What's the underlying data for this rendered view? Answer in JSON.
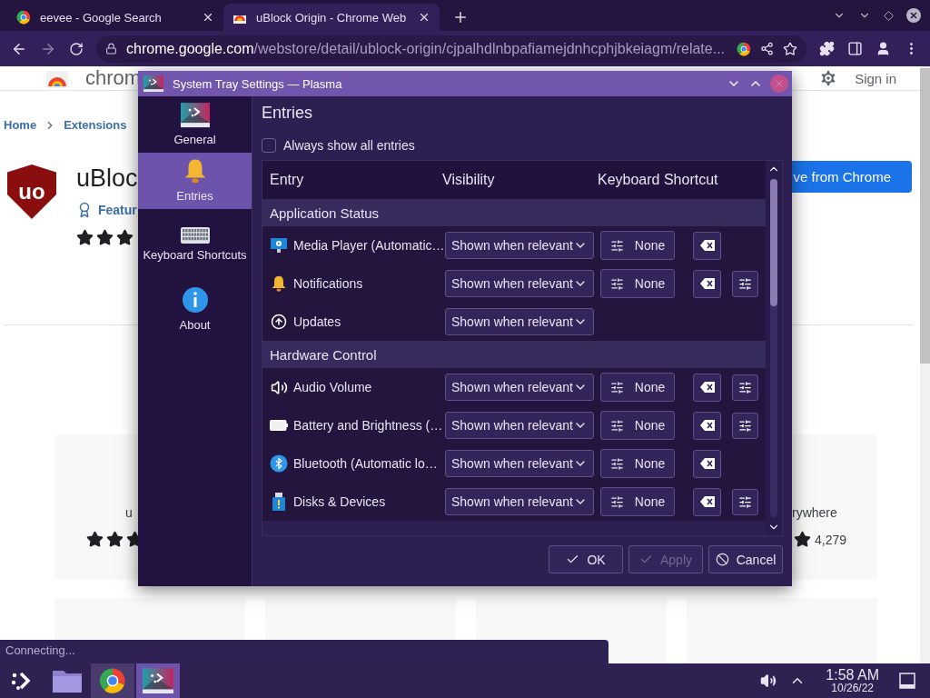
{
  "browser": {
    "tabs": [
      {
        "title": "eevee - Google Search",
        "selected": false
      },
      {
        "title": "uBlock Origin - Chrome Web",
        "selected": true
      }
    ],
    "url": "**chrome.google.com**/webstore/detail/ublock-origin/cjpalhdlnbpafiamejdnhcphjbkeiagm/relate...",
    "page": {
      "logo_text": "chrom",
      "sign_in": "Sign in",
      "breadcrumb": [
        "Home",
        "Extensions"
      ],
      "extension": {
        "badge_text": "uo",
        "title": "uBloc",
        "featured": "Featur",
        "stars": 3,
        "button": "ve from Chrome"
      },
      "cards": [
        {
          "title": "u",
          "stars": 3
        },
        {
          "title": "rywhere",
          "rating": "4,279"
        }
      ]
    }
  },
  "dialog": {
    "title": "System Tray Settings — Plasma",
    "nav": [
      {
        "label": "General",
        "selected": false
      },
      {
        "label": "Entries",
        "selected": true
      },
      {
        "label": "Keyboard Shortcuts",
        "selected": false
      },
      {
        "label": "About",
        "selected": false
      }
    ],
    "heading": "Entries",
    "always_show": {
      "label": "Always show all entries",
      "checked": false
    },
    "columns": [
      "Entry",
      "Visibility",
      "Keyboard Shortcut"
    ],
    "groups": [
      {
        "name": "Application Status",
        "entries": [
          {
            "name": "Media Player (Automatic…",
            "visibility": "Shown when relevant",
            "shortcut": "None",
            "configurable": false,
            "disabled": false
          },
          {
            "name": "Notifications",
            "visibility": "Shown when relevant",
            "shortcut": "None",
            "configurable": true,
            "disabled": false
          },
          {
            "name": "Updates",
            "visibility": "Shown when relevant",
            "configurable": false,
            "disabled": false
          }
        ]
      },
      {
        "name": "Hardware Control",
        "entries": [
          {
            "name": "Audio Volume",
            "visibility": "Shown when relevant",
            "shortcut": "None",
            "configurable": true,
            "disabled": false
          },
          {
            "name": "Battery and Brightness (…",
            "visibility": "Shown when relevant",
            "shortcut": "None",
            "configurable": true,
            "disabled": false
          },
          {
            "name": "Bluetooth (Automatic lo…",
            "visibility": "Shown when relevant",
            "shortcut": "None",
            "configurable": false,
            "disabled": false
          },
          {
            "name": "Disks & Devices",
            "visibility": "Shown when relevant",
            "shortcut": "None",
            "configurable": true,
            "disabled": false
          }
        ]
      }
    ],
    "buttons": [
      {
        "label": "OK",
        "kind": "accept",
        "disabled": false
      },
      {
        "label": "Apply",
        "kind": "accept",
        "disabled": true
      },
      {
        "label": "Cancel",
        "kind": "cancel",
        "disabled": false
      }
    ]
  },
  "status": "Connecting...",
  "taskbar": {
    "tasks": [
      {
        "open": false,
        "selected": false
      },
      {
        "open": true,
        "selected": false
      },
      {
        "open": true,
        "selected": true
      }
    ],
    "time": "1:58 AM",
    "date": "10/26/22"
  }
}
